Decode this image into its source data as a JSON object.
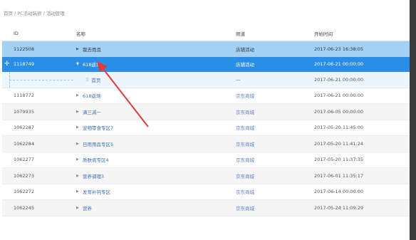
{
  "breadcrumb": [
    "首页",
    "PC活动装修",
    "活动管理"
  ],
  "table": {
    "headers": {
      "id": "ID",
      "name": "名称",
      "channel": "频道",
      "start_time": "开始时间"
    },
    "rows": [
      {
        "id": "1122508",
        "name": "我去而且",
        "channel": "店铺活动",
        "time": "2017-06-23 16:38:05"
      },
      {
        "id": "1118749",
        "name": "618返场",
        "channel": "店铺活动",
        "time": "2017-06-21 00:00:00"
      },
      {
        "id": "",
        "name": "首页",
        "channel": "—",
        "time": "2017-06-21 00:00:00"
      },
      {
        "id": "1118772",
        "name": "618返场",
        "channel": "京东商城",
        "time": "2017-06-21 00:00:00"
      },
      {
        "id": "1079935",
        "name": "满三减一",
        "channel": "京东商城",
        "time": "2017-06-05 00:00:00"
      },
      {
        "id": "1062287",
        "name": "宠物零食专区7",
        "channel": "京东商城",
        "time": "2017-05-20 11:45:00"
      },
      {
        "id": "1062284",
        "name": "日用用品专区5",
        "channel": "京东商城",
        "time": "2017-05-20 11:41:24"
      },
      {
        "id": "1062277",
        "name": "质肤病专区4",
        "channel": "京东商城",
        "time": "2017-05-20 11:37:35"
      },
      {
        "id": "1062273",
        "name": "营养调理3",
        "channel": "京东商城",
        "time": "2017-06-01 11:35:17"
      },
      {
        "id": "1062272",
        "name": "发育补钙专区",
        "channel": "京东商城",
        "time": "2017-06-14 00:00:00"
      },
      {
        "id": "1062245",
        "name": "营养",
        "channel": "京东商城",
        "time": "2017-05-24 11:09:29"
      }
    ]
  },
  "colors": {
    "selected_row": "#2a8ee8",
    "highlight_row": "#a3d1f5",
    "child_row": "#eef6fd",
    "annotation_arrow": "#e03a3a",
    "scrollbar": "#3a3a3a"
  },
  "icons": {
    "expand": "caret-right-icon",
    "collapse": "caret-down-icon",
    "drag": "plus-move-icon",
    "page": "document-icon"
  }
}
